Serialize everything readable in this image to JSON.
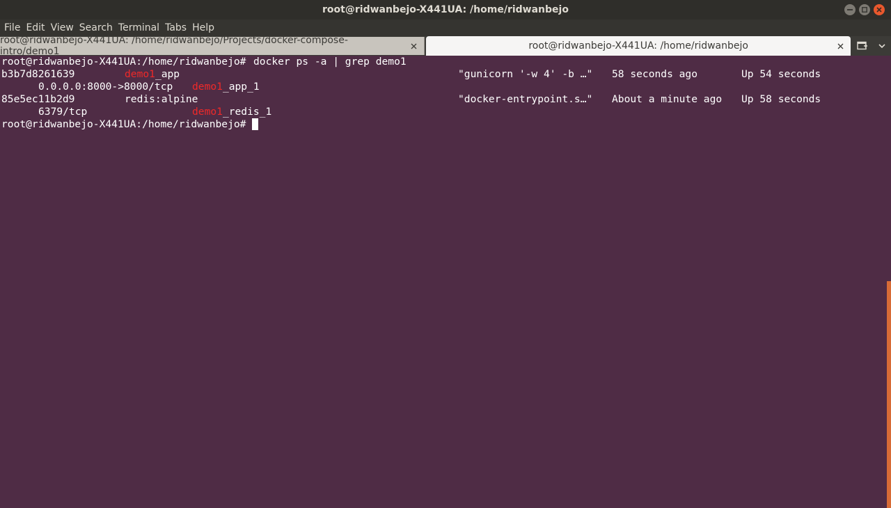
{
  "window": {
    "title": "root@ridwanbejo-X441UA: /home/ridwanbejo"
  },
  "menu": {
    "items": [
      "File",
      "Edit",
      "View",
      "Search",
      "Terminal",
      "Tabs",
      "Help"
    ]
  },
  "tabs": [
    {
      "label": "root@ridwanbejo-X441UA: /home/ridwanbejo/Projects/docker-compose-intro/demo1",
      "active": false
    },
    {
      "label": "root@ridwanbejo-X441UA: /home/ridwanbejo",
      "active": true
    }
  ],
  "icons": {
    "minimize": "minimize-icon",
    "maximize": "maximize-icon",
    "close": "close-icon",
    "tab_close": "close-icon",
    "new_tab": "new-tab-icon",
    "tab_menu": "chevron-down-icon"
  },
  "colors": {
    "terminal_bg": "#4f2c45",
    "match_highlight": "#ef2929",
    "scroll_thumb": "#d76b36"
  },
  "terminal": {
    "prompt": "root@ridwanbejo-X441UA:/home/ridwanbejo# ",
    "command": "docker ps -a | grep demo1",
    "rows": [
      {
        "id": "b3b7d8261639",
        "image_match": "demo1",
        "image_rest": "_app",
        "command": "\"gunicorn '-w 4' -b …\"",
        "created": "58 seconds ago",
        "status": "Up 54 seconds",
        "ports": "0.0.0.0:8000->8000/tcp",
        "name_match": "demo1",
        "name_rest": "_app_1"
      },
      {
        "id": "85e5ec11b2d9",
        "image_match": "",
        "image_rest": "redis:alpine",
        "command": "\"docker-entrypoint.s…\"",
        "created": "About a minute ago",
        "status": "Up 58 seconds",
        "ports": "6379/tcp",
        "name_match": "demo1",
        "name_rest": "_redis_1"
      }
    ],
    "final_prompt": "root@ridwanbejo-X441UA:/home/ridwanbejo# "
  }
}
